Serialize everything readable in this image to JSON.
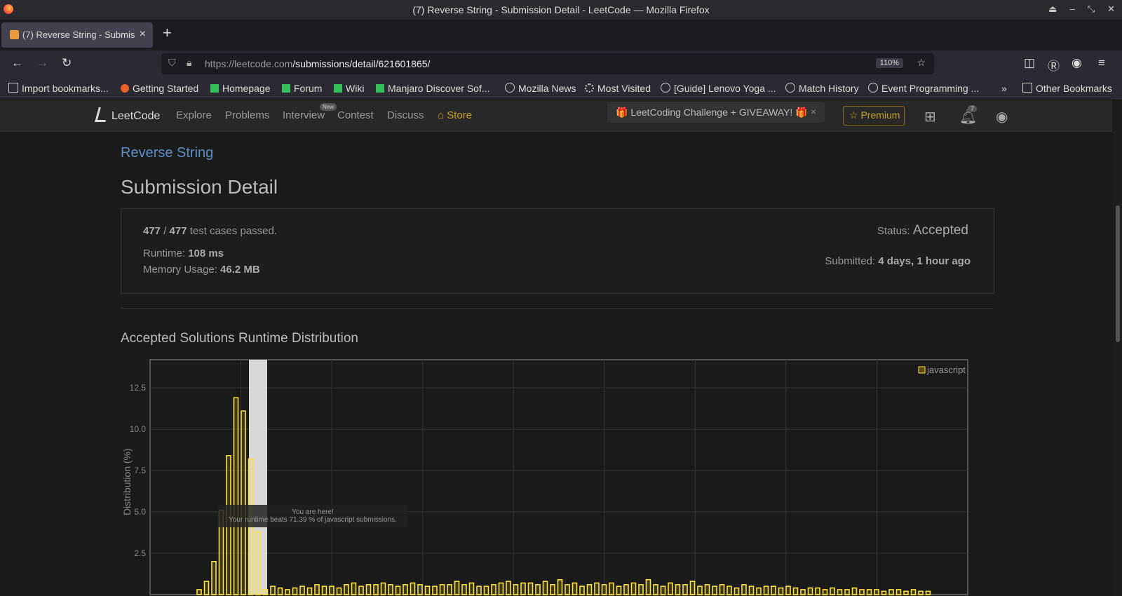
{
  "window": {
    "title": "(7) Reverse String - Submission Detail - LeetCode — Mozilla Firefox"
  },
  "tab": {
    "label": "(7) Reverse String - Submission Detail - LeetCode"
  },
  "address": {
    "host": "https://leetcode.com",
    "path": "/submissions/detail/621601865/",
    "zoom": "110%"
  },
  "bookmarks": [
    "Import bookmarks...",
    "Getting Started",
    "Homepage",
    "Forum",
    "Wiki",
    "Manjaro Discover Sof...",
    "Mozilla News",
    "Most Visited",
    "[Guide] Lenovo Yoga ...",
    "Match History",
    "Event Programming ...",
    "Other Bookmarks"
  ],
  "lc_nav": {
    "logo": "LeetCode",
    "items": [
      "Explore",
      "Problems",
      "Interview",
      "Contest",
      "Discuss"
    ],
    "new_badge": "New",
    "store": "Store",
    "challenge": "🎁 LeetCoding Challenge + GIVEAWAY! 🎁",
    "premium": "☆ Premium",
    "notifications": "7"
  },
  "problem_title": "Reverse String",
  "heading": "Submission Detail",
  "result": {
    "passed": "477",
    "total": "477",
    "passed_suffix": "test cases passed.",
    "runtime_label": "Runtime:",
    "runtime": "108 ms",
    "memory_label": "Memory Usage:",
    "memory": "46.2 MB",
    "status_label": "Status:",
    "status": "Accepted",
    "submitted_label": "Submitted:",
    "submitted": "4 days, 1 hour ago"
  },
  "chart_section_title": "Accepted Solutions Runtime Distribution",
  "chart_data": {
    "type": "bar",
    "ylabel": "Distribution (%)",
    "xlabel": "",
    "ylim": [
      0,
      14.2
    ],
    "yticks": [
      2.5,
      5.0,
      7.5,
      10.0,
      12.5
    ],
    "legend": {
      "entry": "javascript",
      "placement": "top-right"
    },
    "highlighted_index": 8,
    "tooltip": {
      "line1": "You are here!",
      "line2": "Your runtime beats 71.39 % of javascript submissions."
    },
    "colors": {
      "bar": "#ffe33a",
      "bar_fill": "rgba(255,227,58,0.15)",
      "highlight": "#e8e8e8",
      "grid": "#333333"
    },
    "values": [
      0.3,
      0.8,
      2.0,
      5.1,
      8.4,
      11.9,
      11.1,
      8.2,
      3.8,
      0.3,
      0.5,
      0.4,
      0.3,
      0.4,
      0.5,
      0.4,
      0.6,
      0.5,
      0.5,
      0.4,
      0.6,
      0.7,
      0.5,
      0.6,
      0.6,
      0.7,
      0.6,
      0.5,
      0.6,
      0.7,
      0.6,
      0.5,
      0.5,
      0.6,
      0.6,
      0.8,
      0.6,
      0.7,
      0.5,
      0.5,
      0.6,
      0.7,
      0.8,
      0.6,
      0.7,
      0.7,
      0.6,
      0.8,
      0.6,
      0.9,
      0.6,
      0.7,
      0.5,
      0.6,
      0.7,
      0.6,
      0.7,
      0.5,
      0.6,
      0.7,
      0.6,
      0.9,
      0.6,
      0.5,
      0.7,
      0.6,
      0.6,
      0.8,
      0.5,
      0.6,
      0.5,
      0.6,
      0.5,
      0.4,
      0.6,
      0.5,
      0.4,
      0.5,
      0.5,
      0.4,
      0.5,
      0.4,
      0.3,
      0.4,
      0.4,
      0.3,
      0.4,
      0.3,
      0.3,
      0.4,
      0.3,
      0.3,
      0.3,
      0.2,
      0.3,
      0.3,
      0.2,
      0.3,
      0.2,
      0.2
    ]
  }
}
